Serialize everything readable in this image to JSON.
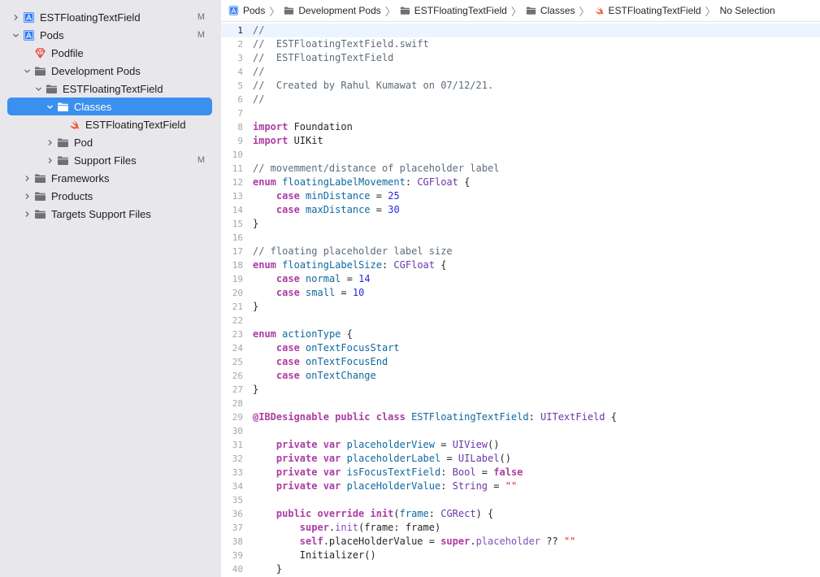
{
  "navigator": {
    "items": [
      {
        "label": "ESTFloatingTextField",
        "icon": "xcode-project-icon",
        "indent": 0,
        "chevron": "right",
        "badge": "M",
        "selected": false
      },
      {
        "label": "Pods",
        "icon": "xcode-project-icon",
        "indent": 0,
        "chevron": "down",
        "badge": "M",
        "selected": false
      },
      {
        "label": "Podfile",
        "icon": "ruby-gem-icon",
        "indent": 1,
        "chevron": "none",
        "badge": "",
        "selected": false
      },
      {
        "label": "Development Pods",
        "icon": "folder-icon",
        "indent": 1,
        "chevron": "down",
        "badge": "",
        "selected": false
      },
      {
        "label": "ESTFloatingTextField",
        "icon": "folder-icon",
        "indent": 2,
        "chevron": "down",
        "badge": "",
        "selected": false
      },
      {
        "label": "Classes",
        "icon": "folder-icon",
        "indent": 3,
        "chevron": "down",
        "badge": "",
        "selected": true
      },
      {
        "label": "ESTFloatingTextField",
        "icon": "swift-icon",
        "indent": 4,
        "chevron": "none",
        "badge": "",
        "selected": false
      },
      {
        "label": "Pod",
        "icon": "folder-icon",
        "indent": 3,
        "chevron": "right",
        "badge": "",
        "selected": false
      },
      {
        "label": "Support Files",
        "icon": "folder-icon",
        "indent": 3,
        "chevron": "right",
        "badge": "M",
        "selected": false
      },
      {
        "label": "Frameworks",
        "icon": "folder-icon",
        "indent": 1,
        "chevron": "right",
        "badge": "",
        "selected": false
      },
      {
        "label": "Products",
        "icon": "folder-icon",
        "indent": 1,
        "chevron": "right",
        "badge": "",
        "selected": false
      },
      {
        "label": "Targets Support Files",
        "icon": "folder-icon",
        "indent": 1,
        "chevron": "right",
        "badge": "",
        "selected": false
      }
    ]
  },
  "jumpbar": {
    "crumbs": [
      {
        "label": "Pods",
        "icon": "xcode-project-icon"
      },
      {
        "label": "Development Pods",
        "icon": "folder-icon"
      },
      {
        "label": "ESTFloatingTextField",
        "icon": "folder-icon"
      },
      {
        "label": "Classes",
        "icon": "folder-icon"
      },
      {
        "label": "ESTFloatingTextField",
        "icon": "swift-icon"
      },
      {
        "label": "No Selection",
        "icon": ""
      }
    ]
  },
  "editor": {
    "current_line": 1,
    "colors": {
      "keyword": "#ad3da4",
      "comment": "#5d6c79",
      "identifier": "#0f68a0",
      "number": "#272ad8",
      "type": "#6c36a9",
      "string": "#d12f1b",
      "selection": "#3b8fef"
    },
    "lines": [
      [
        [
          "com",
          "//"
        ]
      ],
      [
        [
          "com",
          "//  ESTFloatingTextField.swift"
        ]
      ],
      [
        [
          "com",
          "//  ESTFloatingTextField"
        ]
      ],
      [
        [
          "com",
          "//"
        ]
      ],
      [
        [
          "com",
          "//  Created by Rahul Kumawat on 07/12/21."
        ]
      ],
      [
        [
          "com",
          "//"
        ]
      ],
      [],
      [
        [
          "kw",
          "import"
        ],
        [
          "pl",
          " Foundation"
        ]
      ],
      [
        [
          "kw",
          "import"
        ],
        [
          "pl",
          " UIKit"
        ]
      ],
      [],
      [
        [
          "com",
          "// movemment/distance of placeholder label"
        ]
      ],
      [
        [
          "kw",
          "enum"
        ],
        [
          "pl",
          " "
        ],
        [
          "id",
          "floatingLabelMovement"
        ],
        [
          "pl",
          ": "
        ],
        [
          "type",
          "CGFloat"
        ],
        [
          "pl",
          " {"
        ]
      ],
      [
        [
          "pl",
          "    "
        ],
        [
          "kw",
          "case"
        ],
        [
          "pl",
          " "
        ],
        [
          "id",
          "minDistance"
        ],
        [
          "pl",
          " = "
        ],
        [
          "num",
          "25"
        ]
      ],
      [
        [
          "pl",
          "    "
        ],
        [
          "kw",
          "case"
        ],
        [
          "pl",
          " "
        ],
        [
          "id",
          "maxDistance"
        ],
        [
          "pl",
          " = "
        ],
        [
          "num",
          "30"
        ]
      ],
      [
        [
          "pl",
          "}"
        ]
      ],
      [],
      [
        [
          "com",
          "// floating placeholder label size"
        ]
      ],
      [
        [
          "kw",
          "enum"
        ],
        [
          "pl",
          " "
        ],
        [
          "id",
          "floatingLabelSize"
        ],
        [
          "pl",
          ": "
        ],
        [
          "type",
          "CGFloat"
        ],
        [
          "pl",
          " {"
        ]
      ],
      [
        [
          "pl",
          "    "
        ],
        [
          "kw",
          "case"
        ],
        [
          "pl",
          " "
        ],
        [
          "id",
          "normal"
        ],
        [
          "pl",
          " = "
        ],
        [
          "num",
          "14"
        ]
      ],
      [
        [
          "pl",
          "    "
        ],
        [
          "kw",
          "case"
        ],
        [
          "pl",
          " "
        ],
        [
          "id",
          "small"
        ],
        [
          "pl",
          " = "
        ],
        [
          "num",
          "10"
        ]
      ],
      [
        [
          "pl",
          "}"
        ]
      ],
      [],
      [
        [
          "kw",
          "enum"
        ],
        [
          "pl",
          " "
        ],
        [
          "id",
          "actionType"
        ],
        [
          "pl",
          " {"
        ]
      ],
      [
        [
          "pl",
          "    "
        ],
        [
          "kw",
          "case"
        ],
        [
          "pl",
          " "
        ],
        [
          "id",
          "onTextFocusStart"
        ]
      ],
      [
        [
          "pl",
          "    "
        ],
        [
          "kw",
          "case"
        ],
        [
          "pl",
          " "
        ],
        [
          "id",
          "onTextFocusEnd"
        ]
      ],
      [
        [
          "pl",
          "    "
        ],
        [
          "kw",
          "case"
        ],
        [
          "pl",
          " "
        ],
        [
          "id",
          "onTextChange"
        ]
      ],
      [
        [
          "pl",
          "}"
        ]
      ],
      [],
      [
        [
          "kw",
          "@IBDesignable public class"
        ],
        [
          "pl",
          " "
        ],
        [
          "id",
          "ESTFloatingTextField"
        ],
        [
          "pl",
          ": "
        ],
        [
          "type",
          "UITextField"
        ],
        [
          "pl",
          " {"
        ]
      ],
      [],
      [
        [
          "pl",
          "    "
        ],
        [
          "kw",
          "private var"
        ],
        [
          "pl",
          " "
        ],
        [
          "id",
          "placeholderView"
        ],
        [
          "pl",
          " = "
        ],
        [
          "type",
          "UIView"
        ],
        [
          "pl",
          "()"
        ]
      ],
      [
        [
          "pl",
          "    "
        ],
        [
          "kw",
          "private var"
        ],
        [
          "pl",
          " "
        ],
        [
          "id",
          "placeholderLabel"
        ],
        [
          "pl",
          " = "
        ],
        [
          "type",
          "UILabel"
        ],
        [
          "pl",
          "()"
        ]
      ],
      [
        [
          "pl",
          "    "
        ],
        [
          "kw",
          "private var"
        ],
        [
          "pl",
          " "
        ],
        [
          "id",
          "isFocusTextField"
        ],
        [
          "pl",
          ": "
        ],
        [
          "type",
          "Bool"
        ],
        [
          "pl",
          " = "
        ],
        [
          "kw",
          "false"
        ]
      ],
      [
        [
          "pl",
          "    "
        ],
        [
          "kw",
          "private var"
        ],
        [
          "pl",
          " "
        ],
        [
          "id",
          "placeHolderValue"
        ],
        [
          "pl",
          ": "
        ],
        [
          "type",
          "String"
        ],
        [
          "pl",
          " = "
        ],
        [
          "str",
          "\"\""
        ]
      ],
      [],
      [
        [
          "pl",
          "    "
        ],
        [
          "kw",
          "public override init"
        ],
        [
          "pl",
          "("
        ],
        [
          "id",
          "frame"
        ],
        [
          "pl",
          ": "
        ],
        [
          "type",
          "CGRect"
        ],
        [
          "pl",
          ") {"
        ]
      ],
      [
        [
          "pl",
          "        "
        ],
        [
          "kw",
          "super"
        ],
        [
          "pl",
          "."
        ],
        [
          "fn",
          "init"
        ],
        [
          "pl",
          "(frame: frame)"
        ]
      ],
      [
        [
          "pl",
          "        "
        ],
        [
          "kw",
          "self"
        ],
        [
          "pl",
          ".placeHolderValue = "
        ],
        [
          "kw",
          "super"
        ],
        [
          "pl",
          "."
        ],
        [
          "fn",
          "placeholder"
        ],
        [
          "pl",
          " ?? "
        ],
        [
          "str",
          "\"\""
        ]
      ],
      [
        [
          "pl",
          "        Initializer()"
        ]
      ],
      [
        [
          "pl",
          "    }"
        ]
      ]
    ]
  }
}
